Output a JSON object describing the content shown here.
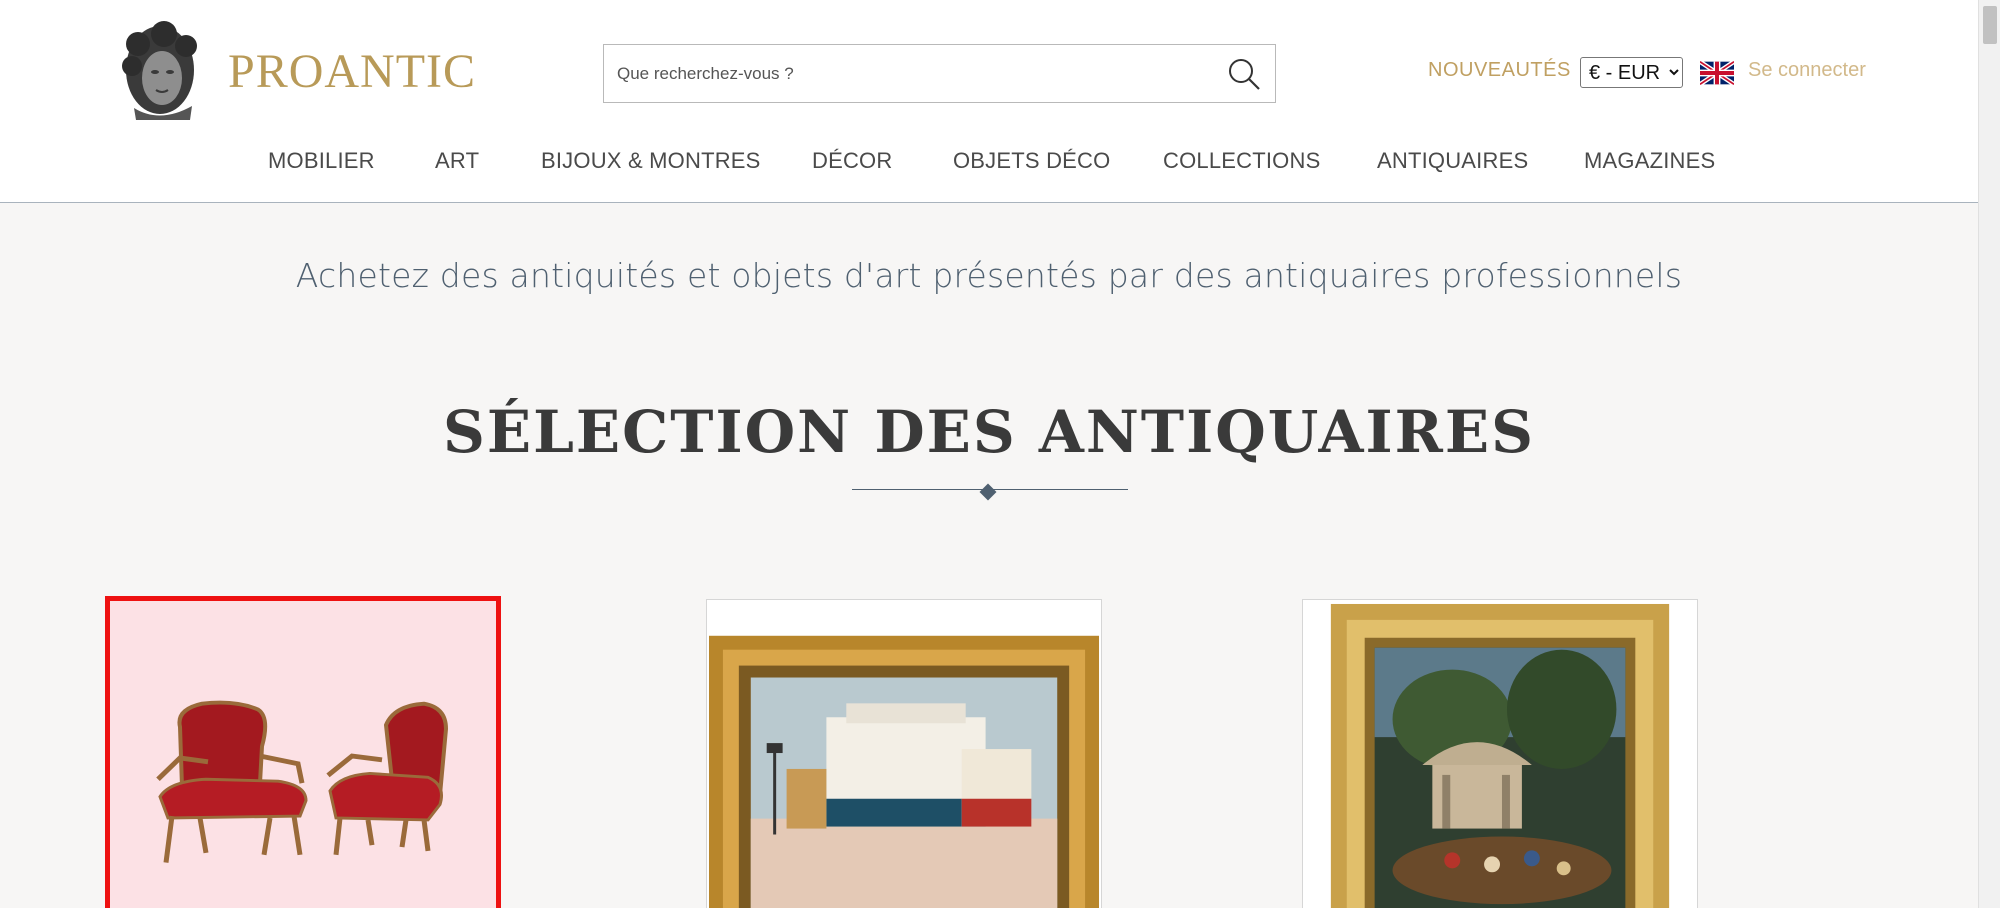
{
  "header": {
    "logo_text": "PROANTIC",
    "search": {
      "placeholder": "Que recherchez-vous ?"
    },
    "nouveautes_label": "NOUVEAUTÉS",
    "currency": {
      "selected": "€ - EUR"
    },
    "flag_icon": "uk-flag-icon",
    "connect_label": "Se connecter"
  },
  "nav": {
    "items": [
      {
        "label": "MOBILIER"
      },
      {
        "label": "ART"
      },
      {
        "label": "BIJOUX & MONTRES"
      },
      {
        "label": "DÉCOR"
      },
      {
        "label": "OBJETS DÉCO"
      },
      {
        "label": "COLLECTIONS"
      },
      {
        "label": "ANTIQUAIRES"
      },
      {
        "label": "MAGAZINES"
      }
    ]
  },
  "main": {
    "tagline": "Achetez des antiquités et objets d'art présentés par des antiquaires professionnels",
    "section_title": "SÉLECTION DES ANTIQUAIRES",
    "cards": [
      {
        "image": "pair-of-red-armchairs"
      },
      {
        "image": "framed-parisian-street-painting"
      },
      {
        "image": "framed-garden-party-painting"
      }
    ]
  },
  "colors": {
    "brand_gold": "#b89a58",
    "accent_blue": "#4f6070",
    "selected_border": "#ee1111"
  }
}
